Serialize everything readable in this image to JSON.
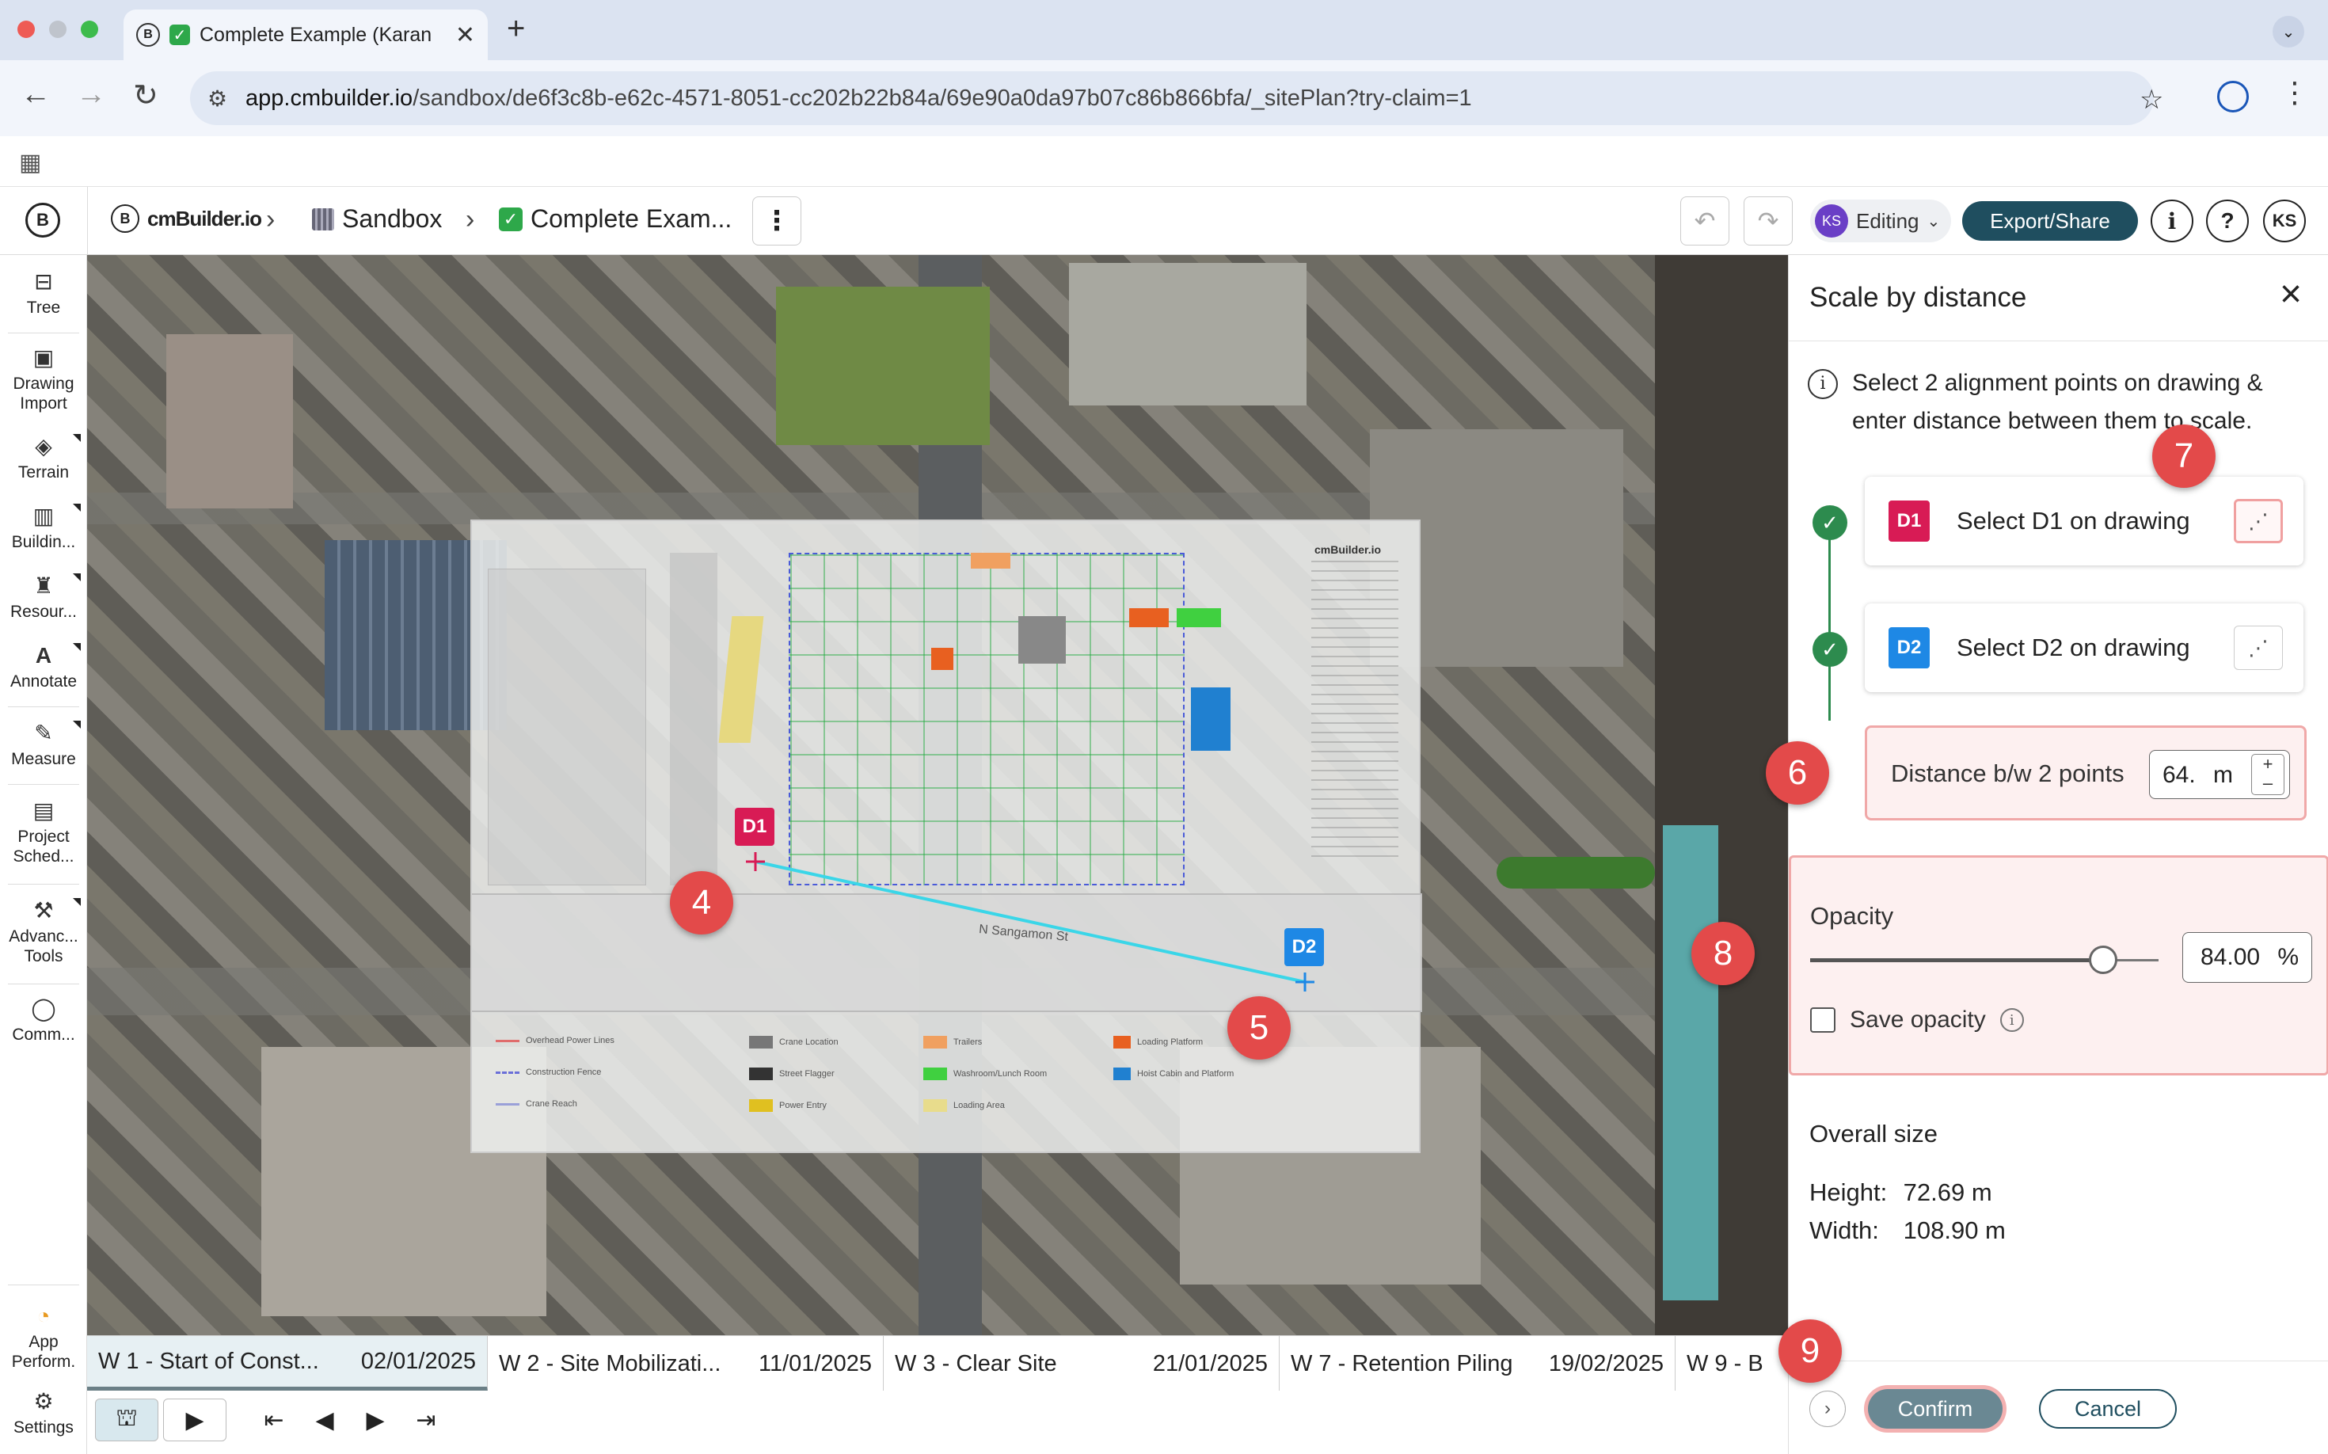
{
  "browser": {
    "tab_title": "Complete Example (Karan",
    "url_host": "app.cmbuilder.io",
    "url_path": "/sandbox/de6f3c8b-e62c-4571-8051-cc202b22b84a/69e90a0da97b07c86b866bfa/_sitePlan?try-claim=1",
    "traffic_colors": [
      "#ee5b55",
      "#bfc4cc",
      "#3dbb4c"
    ]
  },
  "header": {
    "brand": "cmBuilder.io",
    "crumb_sandbox": "Sandbox",
    "crumb_project": "Complete Exam...",
    "editing_avatar": "KS",
    "editing_label": "Editing",
    "export_label": "Export/Share",
    "info_label": "i",
    "help_label": "?",
    "user_initials": "KS"
  },
  "tools": [
    {
      "label": "Tree",
      "icon": "tree-icon"
    },
    {
      "label": "Drawing Import",
      "icon": "image-icon"
    },
    {
      "label": "Terrain",
      "icon": "layers-icon"
    },
    {
      "label": "Buildin...",
      "icon": "building-icon"
    },
    {
      "label": "Resour...",
      "icon": "crane-icon"
    },
    {
      "label": "Annotate",
      "icon": "annotate-icon"
    },
    {
      "label": "Measure",
      "icon": "ruler-icon"
    },
    {
      "label": "Project Sched...",
      "icon": "calendar-icon"
    },
    {
      "label": "Advanc... Tools",
      "icon": "tools-icon"
    },
    {
      "label": "Comm...",
      "icon": "comment-icon"
    },
    {
      "label": "App Perform.",
      "icon": "gauge-icon"
    },
    {
      "label": "Settings",
      "icon": "gear-icon"
    }
  ],
  "map": {
    "d1_label": "D1",
    "d2_label": "D2",
    "step_4": "4",
    "step_5": "5",
    "street_label": "N Sangamon St",
    "plan_brand": "cmBuilder.io"
  },
  "legend": [
    {
      "label": "Overhead Power Lines",
      "color": "#e06c6c"
    },
    {
      "label": "Construction Fence",
      "color": "#6a6fd8"
    },
    {
      "label": "Crane Reach",
      "color": "#9aa0d8"
    },
    {
      "label": "Crane Location",
      "color": "#777777"
    },
    {
      "label": "Street Flagger",
      "color": "#333333"
    },
    {
      "label": "Power Entry",
      "color": "#e0c020"
    },
    {
      "label": "Trailers",
      "color": "#f0a060"
    },
    {
      "label": "Washroom/Lunch Room",
      "color": "#40d040"
    },
    {
      "label": "Loading Area",
      "color": "#e8dc8c"
    },
    {
      "label": "Loading Platform",
      "color": "#e86020"
    },
    {
      "label": "Hoist Cabin and Platform",
      "color": "#2080d0"
    }
  ],
  "timeline": [
    {
      "name": "W 1 - Start of Const...",
      "date": "02/01/2025",
      "active": true
    },
    {
      "name": "W 2 - Site Mobilizati...",
      "date": "11/01/2025"
    },
    {
      "name": "W 3 - Clear Site",
      "date": "21/01/2025"
    },
    {
      "name": "W 7 - Retention Piling",
      "date": "19/02/2025"
    },
    {
      "name": "W 9 - B",
      "date": ""
    }
  ],
  "panel": {
    "title": "Scale by distance",
    "info_text": "Select 2 alignment points on drawing & enter distance between them to scale.",
    "d1_badge": "D1",
    "d1_text": "Select D1 on drawing",
    "d2_badge": "D2",
    "d2_text": "Select D2 on drawing",
    "distance_label": "Distance b/w 2 points",
    "distance_value": "64.",
    "distance_unit": "m",
    "opacity_label": "Opacity",
    "opacity_value": "84.00",
    "opacity_unit": "%",
    "opacity_level": 0.84,
    "save_opacity_label": "Save opacity",
    "overall_size_title": "Overall size",
    "height_label": "Height:",
    "height_value": "72.69 m",
    "width_label": "Width:",
    "width_value": "108.90 m",
    "confirm_label": "Confirm",
    "cancel_label": "Cancel",
    "step_6": "6",
    "step_7": "7",
    "step_8": "8",
    "step_9": "9"
  },
  "colors": {
    "d1": "#d81b55",
    "d2": "#1e88e5",
    "step": "#e34a4a",
    "line": "#3ad6e8"
  }
}
